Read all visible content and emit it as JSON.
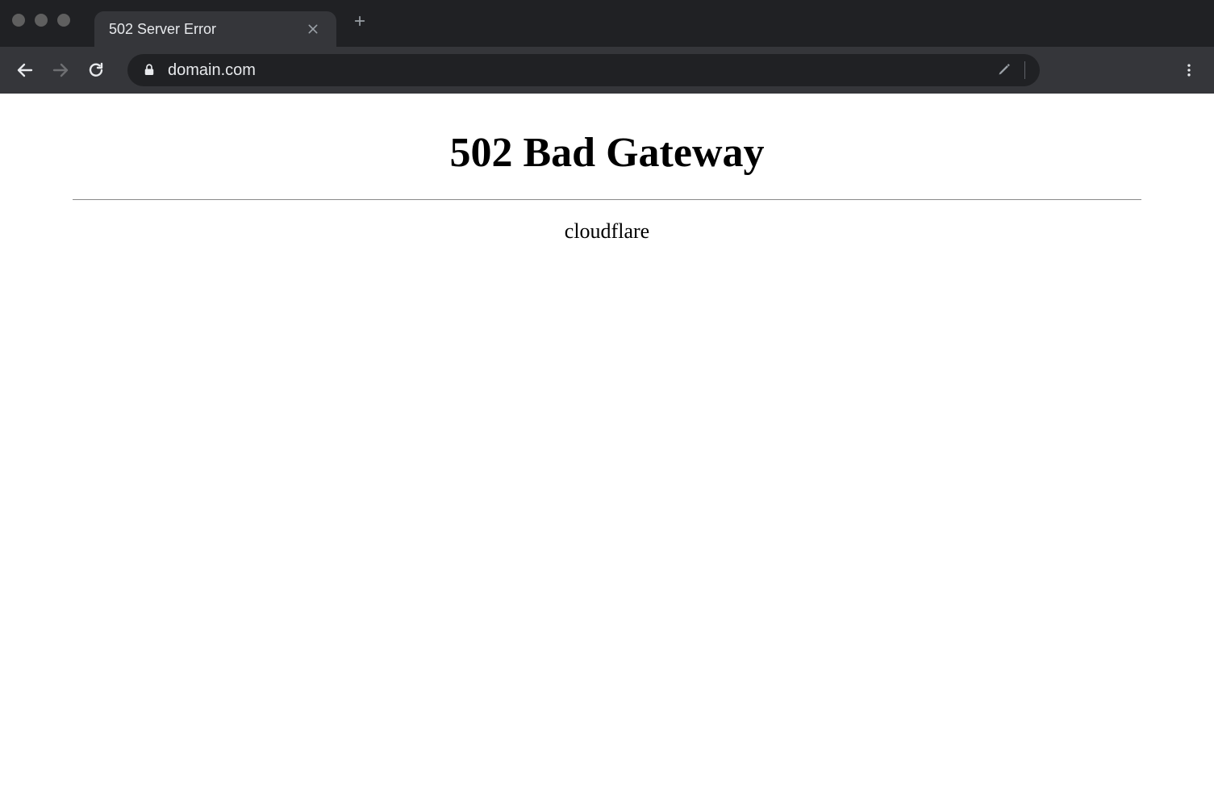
{
  "browser": {
    "tab": {
      "title": "502 Server Error"
    },
    "address": {
      "url": "domain.com"
    }
  },
  "page": {
    "heading": "502 Bad Gateway",
    "server": "cloudflare"
  }
}
